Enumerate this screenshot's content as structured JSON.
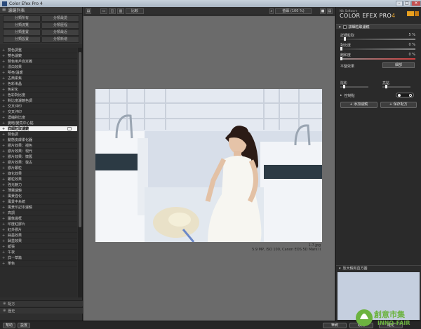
{
  "window": {
    "title": "Color Efex Pro 4"
  },
  "left": {
    "header": "濾鏡列表",
    "tabs": [
      "分類所有",
      "分類最愛",
      "分類流覽",
      "分類歷程",
      "分類重置",
      "分類最近",
      "分類設置",
      "分類新增"
    ],
    "filters": [
      "雙色調整",
      "雙色濾鏡",
      "雙色用戶自定義",
      "漂白效果",
      "明亮/溫暖",
      "古典柔焦",
      "色彩漸晶",
      "色彩化",
      "色彩對比度",
      "對比度濾鏡色調",
      "交叉沖印",
      "交叉沖印",
      "濃縮對比度",
      "變暗/變亮中心點",
      "詳細粒取濾鏡",
      "雙色調",
      "動態皮膚柔化器",
      "膠片效果：褪色",
      "膠片效果：現代",
      "膠片效果：懷舊",
      "膠片效果：復古",
      "膠片顆粒",
      "綠化效果",
      "顆粒效果",
      "強光魅力",
      "薄霧濾鏡",
      "風景強化",
      "風景中糸統",
      "風景印記本濾鏡",
      "高調",
      "圖像邊框",
      "印度紅膠片",
      "紅外膠片",
      "曲墨效果",
      "歸墨效果",
      "紙張",
      "午夜",
      "詳一草篇",
      "單色"
    ],
    "selected_index": 14,
    "sections": {
      "presets": "配方",
      "history": "歷史"
    }
  },
  "toolbar": {
    "compare": "比較",
    "zoom": "螢幕 (100 %)"
  },
  "photo_caption": {
    "filename": "1-7.jpg",
    "meta": "5.9 MP, ISO 100, Canon EOS 5D Mark II"
  },
  "right": {
    "brand_small": "Nik Software",
    "brand_name": "COLOR EFEX PRO",
    "brand_version": "4",
    "filter_header": "詳細粒取濾鏡",
    "sliders": [
      {
        "label": "詳細粒取",
        "value": "5 %",
        "pos": 0.05
      },
      {
        "label": "對比度",
        "value": "0 %",
        "pos": 0.0
      },
      {
        "label": "飽和度",
        "value": "0 %",
        "pos": 0.0
      }
    ],
    "select": {
      "label": "平整效果",
      "value": "細部"
    },
    "shadows": {
      "label": "陰影",
      "pos": 0.1
    },
    "highlights": {
      "label": "亮點",
      "pos": 0.1
    },
    "control_points": "控制點",
    "add_filter": "+ 添加濾鏡",
    "save_preset": "+ 保存配方",
    "loupe_header": "放大鏡和直方圖"
  },
  "bottom": {
    "help": "幫助",
    "settings": "設置",
    "brush": "筆刷",
    "cancel": "取消",
    "ok": "確定"
  },
  "watermark": {
    "text_cn": "創意市集",
    "text_en": "INNO-FAIR"
  }
}
